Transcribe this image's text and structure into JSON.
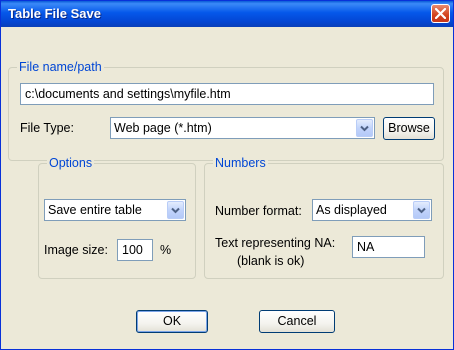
{
  "window": {
    "title": "Table File Save"
  },
  "file_group": {
    "legend": "File name/path",
    "path_value": "c:\\documents and settings\\myfile.htm",
    "file_type_label": "File Type:",
    "file_type_value": "Web page (*.htm)",
    "browse_label": "Browse"
  },
  "options_group": {
    "legend": "Options",
    "save_value": "Save entire table",
    "image_size_label": "Image size:",
    "image_size_value": "100",
    "percent_sign": "%"
  },
  "numbers_group": {
    "legend": "Numbers",
    "number_format_label": "Number format:",
    "number_format_value": "As displayed",
    "na_label_line1": "Text representing NA:",
    "na_label_line2": "(blank is ok)",
    "na_value": "NA"
  },
  "buttons": {
    "ok": "OK",
    "cancel": "Cancel"
  },
  "colors": {
    "titlebar": "#0558ea",
    "dialog_bg": "#ece9d8",
    "legend_text": "#0046d5",
    "close_button": "#d2421c"
  },
  "icons": {
    "close": "close-x-icon",
    "dropdown": "chevron-down-icon"
  }
}
